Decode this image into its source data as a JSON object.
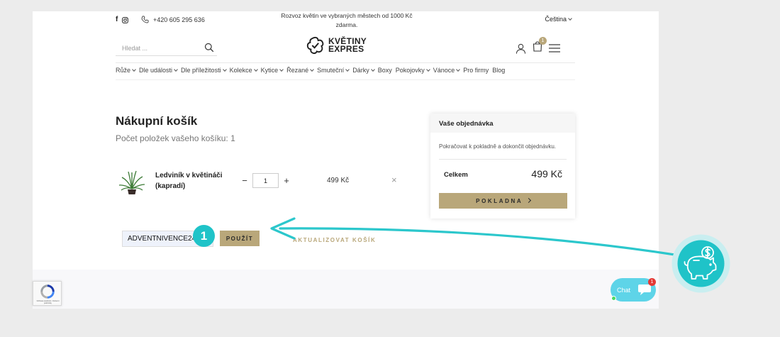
{
  "topbar": {
    "phone": "+420 605 295 636",
    "promo": "Rozvoz květin ve vybraných městech od 1000 Kč zdarma.",
    "language": "Čeština"
  },
  "search": {
    "placeholder": "Hledat ..."
  },
  "logo": {
    "line1": "KVĚTINY",
    "line2": "EXPRES"
  },
  "cart_badge": "1",
  "nav": [
    {
      "label": "Růže",
      "caret": true
    },
    {
      "label": "Dle události",
      "caret": true
    },
    {
      "label": "Dle příležitosti",
      "caret": true
    },
    {
      "label": "Kolekce",
      "caret": true
    },
    {
      "label": "Kytice",
      "caret": true
    },
    {
      "label": "Řezané",
      "caret": true
    },
    {
      "label": "Smuteční",
      "caret": true
    },
    {
      "label": "Dárky",
      "caret": true
    },
    {
      "label": "Boxy",
      "caret": false
    },
    {
      "label": "Pokojovky",
      "caret": true
    },
    {
      "label": "Vánoce",
      "caret": true
    },
    {
      "label": "Pro firmy",
      "caret": false
    },
    {
      "label": "Blog",
      "caret": false
    }
  ],
  "cart": {
    "title": "Nákupní košík",
    "count_text": "Počet položek vašeho košíku: 1",
    "item": {
      "name": "Ledviník v květináči (kapradí)",
      "quantity": "1",
      "price": "499 Kč",
      "minus": "−",
      "plus": "+",
      "remove": "×"
    },
    "coupon_value": "ADVENTNIVENCE24",
    "apply_label": "POUŽÍT",
    "update_label": "AKTUALIZOVAT KOŠÍK"
  },
  "summary": {
    "title": "Vaše objednávka",
    "description": "Pokračovat k pokladně a dokončit objednávku.",
    "total_label": "Celkem",
    "total_value": "499 Kč",
    "checkout_label": "POKLADNA"
  },
  "recaptcha": {
    "text": "Ochrana soukromí • Smluvní podmínky"
  },
  "chat": {
    "label": "Chat",
    "badge": "1"
  },
  "overlay": {
    "step": "1"
  },
  "colors": {
    "accent": "#b9a77a",
    "teal": "#1fc3c8",
    "chat": "#5ed4e8"
  }
}
